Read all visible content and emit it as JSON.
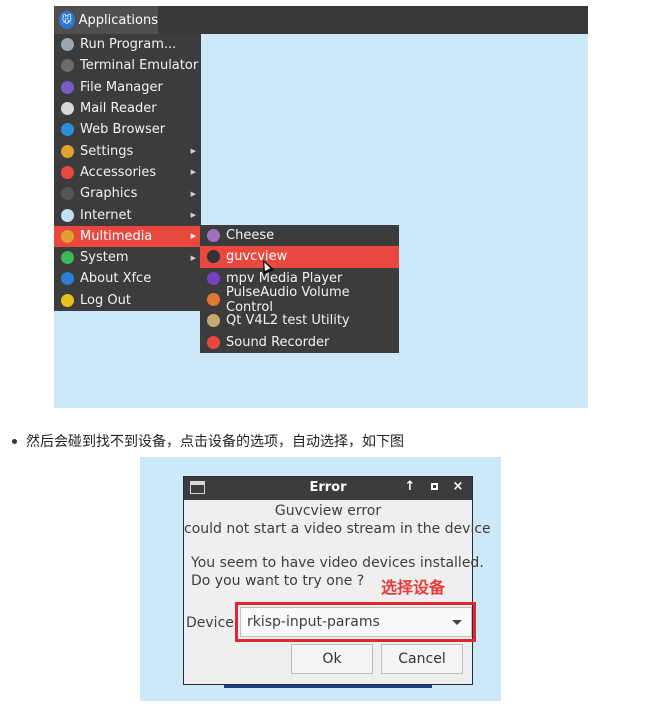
{
  "screenshot1": {
    "panel": {
      "applications_label": "Applications",
      "logo_icon": "xfce-mouse-icon"
    },
    "main_menu": [
      {
        "label": "Run Program...",
        "icon": "gears-icon",
        "color": "#9aa7b0",
        "submenu": false
      },
      {
        "label": "Terminal Emulator",
        "icon": "terminal-icon",
        "color": "#6b6b6b",
        "submenu": false
      },
      {
        "label": "File Manager",
        "icon": "folder-icon",
        "color": "#7a5cc4",
        "submenu": false
      },
      {
        "label": "Mail Reader",
        "icon": "mail-icon",
        "color": "#d8d8d8",
        "submenu": false
      },
      {
        "label": "Web Browser",
        "icon": "globe-icon",
        "color": "#2d8fd8",
        "submenu": false
      },
      {
        "label": "Settings",
        "icon": "settings-icon",
        "color": "#e0a030",
        "submenu": true
      },
      {
        "label": "Accessories",
        "icon": "accessories-icon",
        "color": "#e8483e",
        "submenu": true
      },
      {
        "label": "Graphics",
        "icon": "graphics-icon",
        "color": "#555555",
        "submenu": true
      },
      {
        "label": "Internet",
        "icon": "cloud-icon",
        "color": "#bfe0f5",
        "submenu": true
      },
      {
        "label": "Multimedia",
        "icon": "multimedia-icon",
        "color": "#e0a030",
        "submenu": true,
        "active": true
      },
      {
        "label": "System",
        "icon": "system-icon",
        "color": "#3cba54",
        "submenu": true
      },
      {
        "label": "About Xfce",
        "icon": "info-icon",
        "color": "#2d7fd8",
        "submenu": false
      },
      {
        "label": "Log Out",
        "icon": "logout-icon",
        "color": "#e8c020",
        "submenu": false
      }
    ],
    "multimedia_submenu": [
      {
        "label": "Cheese",
        "icon": "cheese-icon",
        "color": "#a070c0"
      },
      {
        "label": "guvcview",
        "icon": "webcam-icon",
        "color": "#333333",
        "active": true
      },
      {
        "label": "mpv Media Player",
        "icon": "mpv-icon",
        "color": "#7a3fc0"
      },
      {
        "label": "PulseAudio Volume Control",
        "icon": "volume-icon",
        "color": "#e07830"
      },
      {
        "label": "Qt V4L2 test Utility",
        "icon": "qt-v4l2-icon",
        "color": "#c9a870"
      },
      {
        "label": "Sound Recorder",
        "icon": "microphone-icon",
        "color": "#e8483e"
      }
    ]
  },
  "bullet_text": "然后会碰到找不到设备，点击设备的选项，自动选择，如下图",
  "dialog": {
    "title": "Error",
    "title_buttons": {
      "up": "↑",
      "close": "×"
    },
    "error_heading": "Guvcview error",
    "error_message": "could not start a video stream in the device",
    "question_line1": "You seem to have video devices installed.",
    "question_line2": "Do you want to try one ?",
    "annotation": "选择设备",
    "device_label": "Device:",
    "device_value": "rkisp-input-params",
    "ok_label": "Ok",
    "cancel_label": "Cancel",
    "highlight_color": "#e0262e"
  }
}
